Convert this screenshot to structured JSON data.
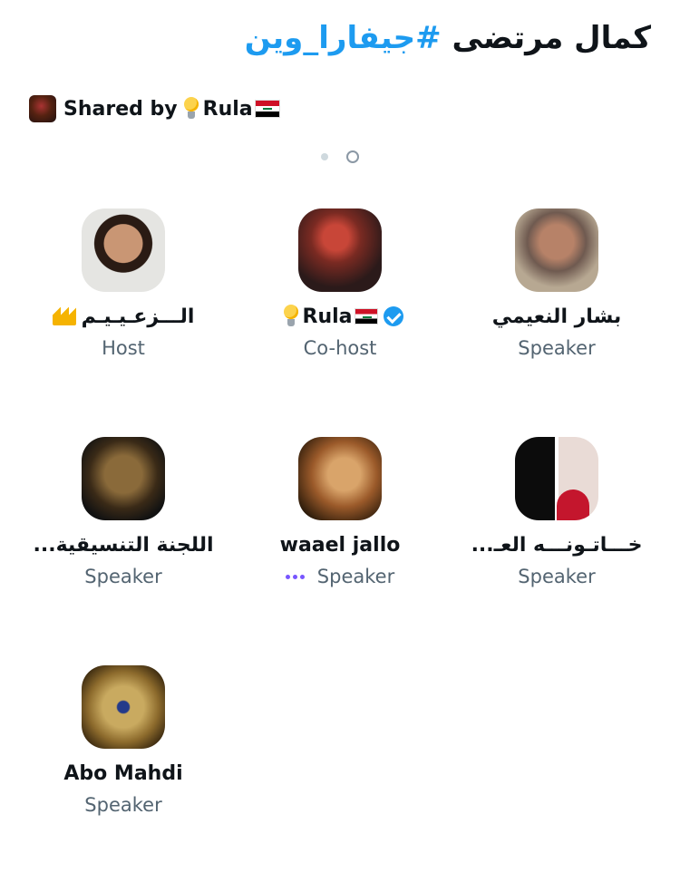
{
  "header": {
    "title_text": "كمال مرتضى ",
    "title_hashtag": "#جيفارا_وين",
    "shared_prefix": "Shared by",
    "shared_name": "Rula"
  },
  "participants": [
    {
      "name": "الـــزعـيـيـم",
      "role": "Host"
    },
    {
      "name": "Rula",
      "role": "Co-host",
      "verified": true
    },
    {
      "name": "بشار النعيمي",
      "role": "Speaker"
    },
    {
      "name": "اللجنة التنسيقية...",
      "role": "Speaker"
    },
    {
      "name": "waael jallo",
      "role": "Speaker",
      "speaking": true
    },
    {
      "name": "خـــاتـونـــه العـ...",
      "role": "Speaker"
    },
    {
      "name": "Abo Mahdi",
      "role": "Speaker"
    }
  ],
  "pager": {
    "pages": 2,
    "current": 2
  },
  "icons": [
    "bulb-icon",
    "iraq-flag-icon",
    "crown-icon",
    "verified-badge-icon",
    "speaking-indicator-icon"
  ],
  "colors": {
    "accent": "#1d9bf0",
    "speaking": "#7856ff",
    "secondary_text": "#536471"
  }
}
